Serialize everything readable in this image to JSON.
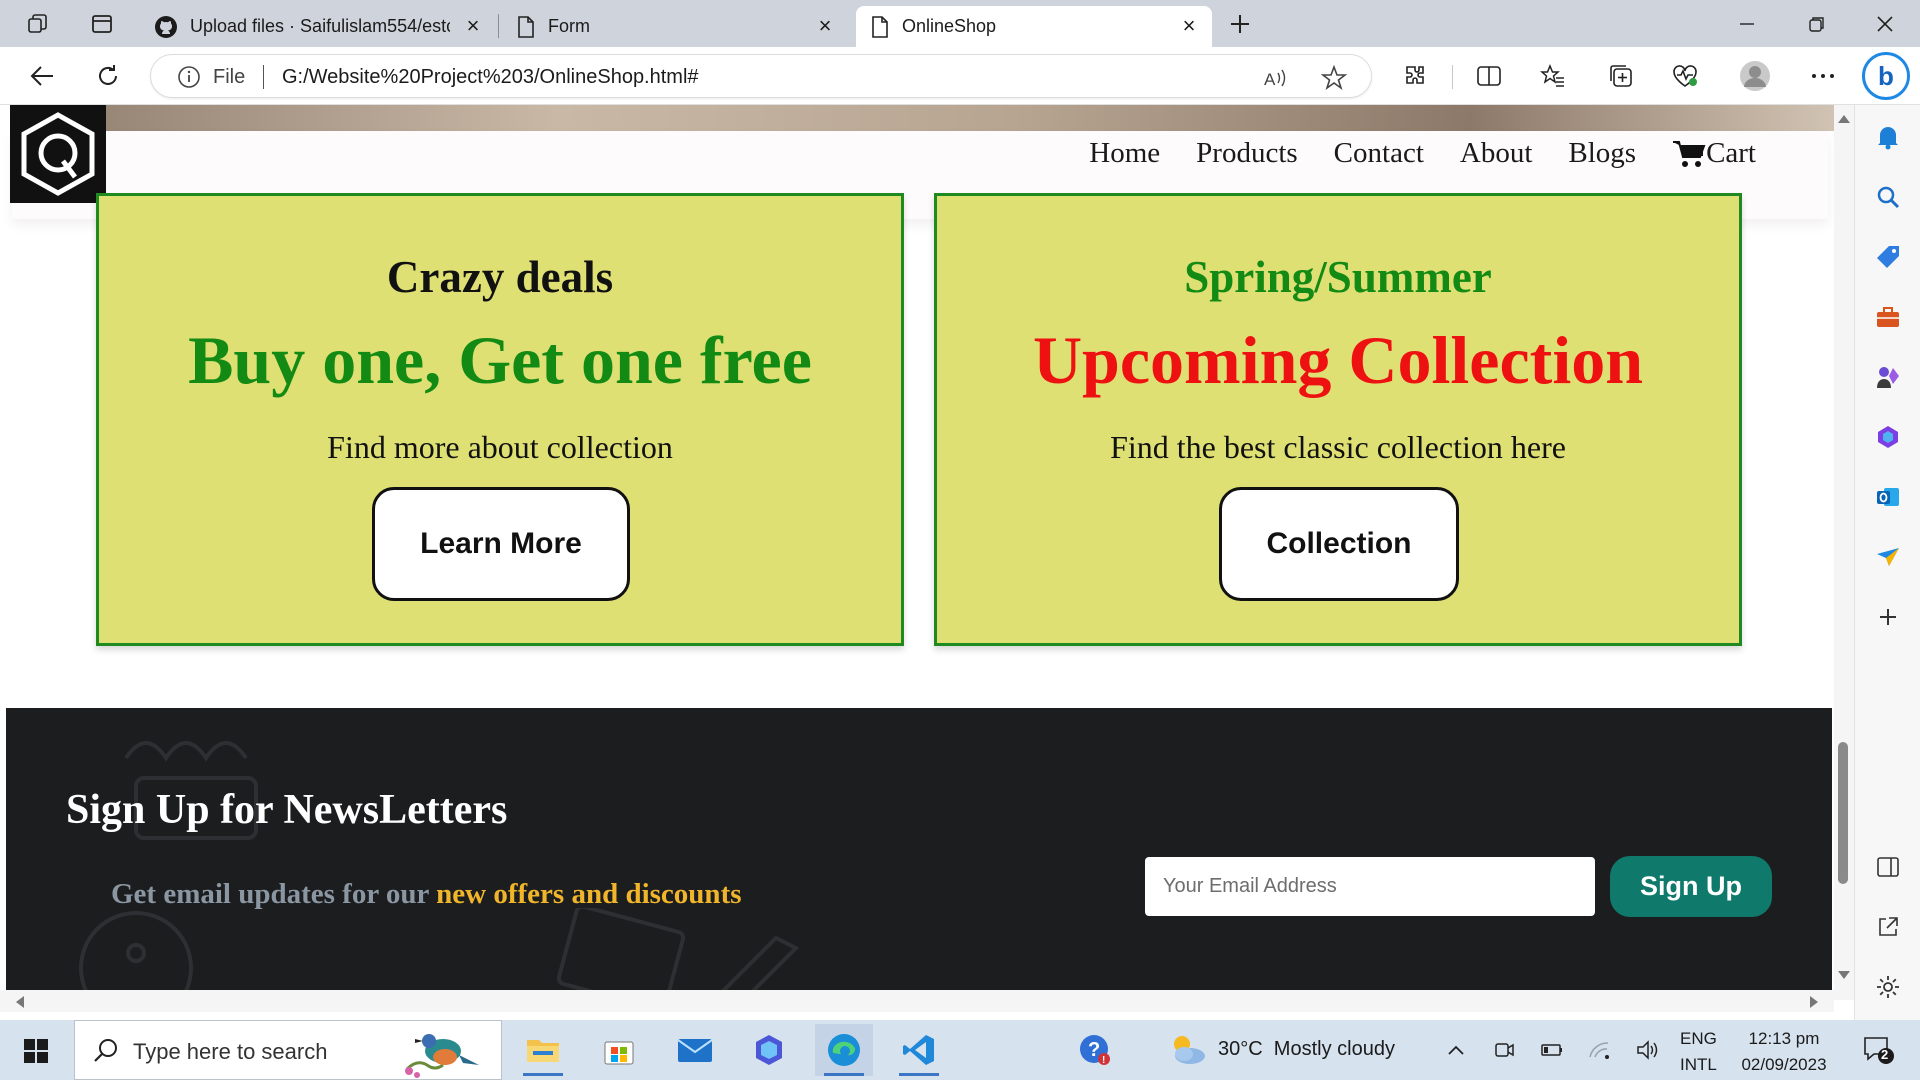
{
  "browser": {
    "tabs": [
      {
        "title": "Upload files · Saifulislam554/estc",
        "active": false
      },
      {
        "title": "Form",
        "active": false
      },
      {
        "title": "OnlineShop",
        "active": true
      }
    ],
    "address": {
      "scheme_label": "File",
      "url": "G:/Website%20Project%203/OnlineShop.html#"
    }
  },
  "site": {
    "nav": {
      "home": "Home",
      "products": "Products",
      "contact": "Contact",
      "about": "About",
      "blogs": "Blogs",
      "cart": "Cart"
    },
    "promo_left": {
      "kicker": "Crazy deals",
      "headline": "Buy one, Get one free",
      "subtext": "Find more about collection",
      "button": "Learn More",
      "kicker_color": "#111111",
      "headline_color": "#138a13"
    },
    "promo_right": {
      "kicker": "Spring/Summer",
      "headline": "Upcoming Collection",
      "subtext": "Find the best classic collection here",
      "button": "Collection",
      "kicker_color": "#138a13",
      "headline_color": "#ee1111"
    },
    "newsletter": {
      "title": "Sign Up for NewsLetters",
      "text_prefix": "Get email updates for our ",
      "text_highlight": "new offers and discounts",
      "email_placeholder": "Your Email Address",
      "button": "Sign Up",
      "accent_color": "#0f7a6c"
    }
  },
  "taskbar": {
    "search_placeholder": "Type here to search",
    "weather": "30°C  Mostly cloudy",
    "lang_top": "ENG",
    "lang_bottom": "INTL",
    "time": "12:13 pm",
    "date": "02/09/2023",
    "notification_count": "2"
  }
}
